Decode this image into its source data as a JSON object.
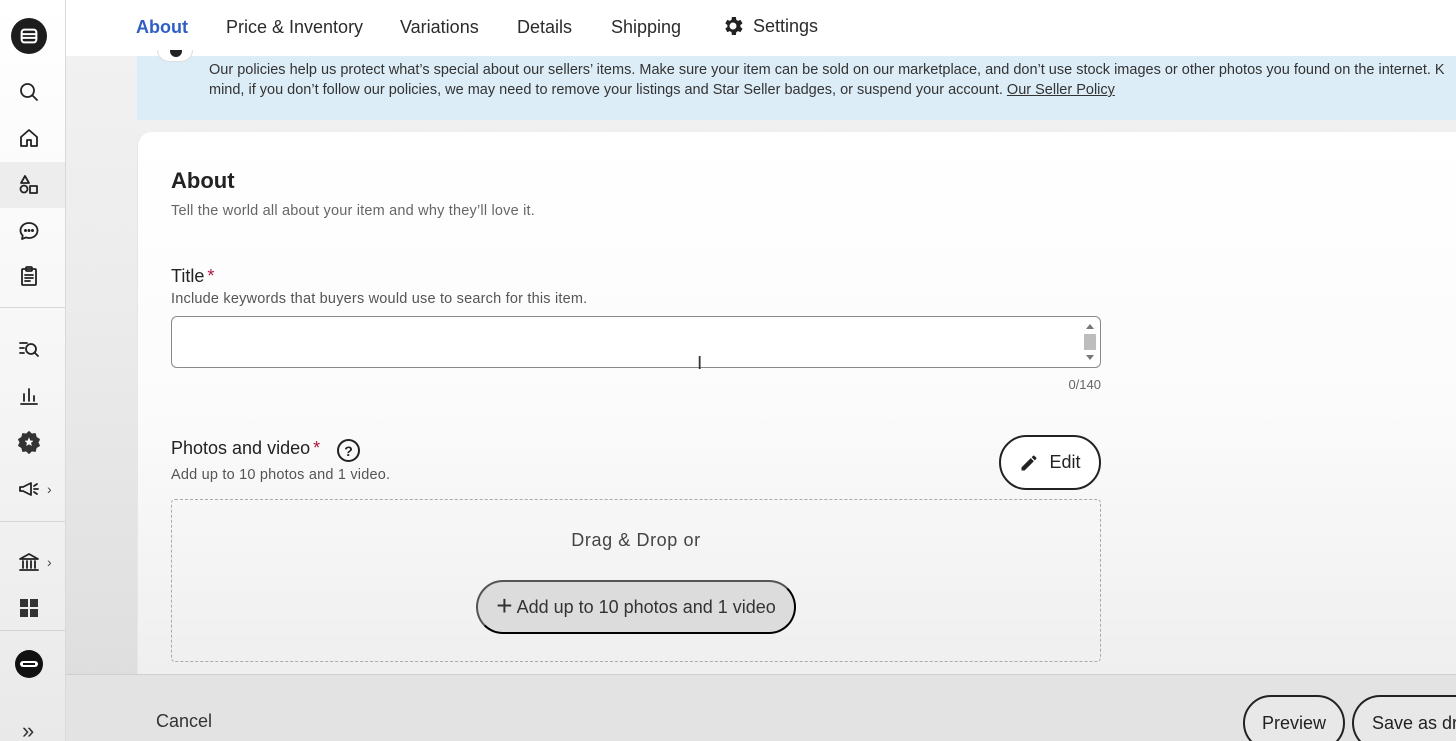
{
  "tabs": {
    "about": "About",
    "price_inventory": "Price & Inventory",
    "variations": "Variations",
    "details": "Details",
    "shipping": "Shipping",
    "settings": "Settings"
  },
  "banner": {
    "text_line1": "Our policies help us protect what’s special about our sellers’ items. Make sure your item can be sold on our marketplace, and don’t use stock images or other photos you found on the internet. K",
    "text_line2": "mind, if you don’t follow our policies, we may need to remove your listings and Star Seller badges, or suspend your account.",
    "link": "Our Seller Policy"
  },
  "about_section": {
    "heading": "About",
    "subtitle": "Tell the world all about your item and why they’ll love it."
  },
  "title_field": {
    "label": "Title",
    "required_mark": "*",
    "hint": "Include keywords that buyers would use to search for this item.",
    "value": "",
    "counter": "0/140"
  },
  "photos_field": {
    "label": "Photos and video",
    "required_mark": "*",
    "help_glyph": "?",
    "hint": "Add up to 10 photos and 1 video.",
    "edit_label": "Edit",
    "drop_text": "Drag & Drop or",
    "add_plus": "+",
    "add_label": "Add up to 10 photos and 1 video"
  },
  "footer": {
    "cancel": "Cancel",
    "preview": "Preview",
    "save": "Save as dr"
  },
  "sidebar": {
    "icons": [
      "shop-logo-icon",
      "search-icon",
      "home-icon",
      "listings-icon",
      "messages-icon",
      "orders-icon",
      "stats-search-icon",
      "stats-icon",
      "star-seller-icon",
      "marketing-icon",
      "finances-icon",
      "apps-icon",
      "avatar",
      "expand-icon"
    ]
  },
  "colors": {
    "active_tab": "#2f5fc4",
    "banner_bg": "#dcedf7",
    "required": "#b0153b"
  }
}
